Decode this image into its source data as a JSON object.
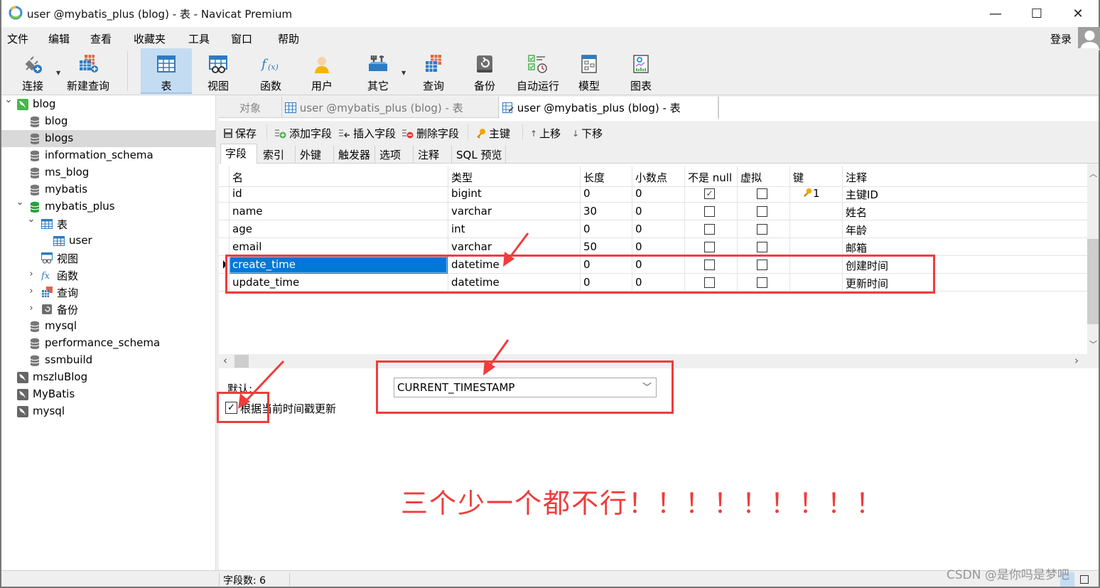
{
  "window": {
    "title": "user @mybatis_plus (blog) - 表 - Navicat Premium",
    "minimize": "—",
    "maximize": "☐",
    "close": "✕"
  },
  "menu": {
    "items": [
      "文件",
      "编辑",
      "查看",
      "收藏夹",
      "工具",
      "窗口",
      "帮助"
    ],
    "login": "登录"
  },
  "toolbar": {
    "items": [
      {
        "label": "连接",
        "icon": "plug-icon"
      },
      {
        "label": "新建查询",
        "icon": "new-query-icon"
      },
      {
        "label": "表",
        "icon": "table-icon",
        "active": true
      },
      {
        "label": "视图",
        "icon": "view-icon"
      },
      {
        "label": "函数",
        "icon": "function-icon"
      },
      {
        "label": "用户",
        "icon": "user-icon"
      },
      {
        "label": "其它",
        "icon": "tools-icon"
      },
      {
        "label": "查询",
        "icon": "query-icon"
      },
      {
        "label": "备份",
        "icon": "backup-icon"
      },
      {
        "label": "自动运行",
        "icon": "schedule-icon"
      },
      {
        "label": "模型",
        "icon": "model-icon"
      },
      {
        "label": "图表",
        "icon": "chart-icon"
      }
    ]
  },
  "tree": {
    "nodes": [
      {
        "label": "blog",
        "type": "connection",
        "level": 0,
        "expanded": true
      },
      {
        "label": "blog",
        "type": "database",
        "level": 1
      },
      {
        "label": "blogs",
        "type": "database",
        "level": 1,
        "selected": true
      },
      {
        "label": "information_schema",
        "type": "database",
        "level": 1
      },
      {
        "label": "ms_blog",
        "type": "database",
        "level": 1
      },
      {
        "label": "mybatis",
        "type": "database",
        "level": 1
      },
      {
        "label": "mybatis_plus",
        "type": "database-open",
        "level": 1,
        "expanded": true
      },
      {
        "label": "表",
        "type": "tables",
        "level": 2,
        "expanded": true
      },
      {
        "label": "user",
        "type": "table",
        "level": 3
      },
      {
        "label": "视图",
        "type": "views",
        "level": 2
      },
      {
        "label": "函数",
        "type": "functions",
        "level": 2,
        "collapsed": true
      },
      {
        "label": "查询",
        "type": "queries",
        "level": 2,
        "collapsed": true
      },
      {
        "label": "备份",
        "type": "backups",
        "level": 2,
        "collapsed": true
      },
      {
        "label": "mysql",
        "type": "database",
        "level": 1
      },
      {
        "label": "performance_schema",
        "type": "database",
        "level": 1
      },
      {
        "label": "ssmbuild",
        "type": "database",
        "level": 1
      },
      {
        "label": "mszluBlog",
        "type": "connection-closed",
        "level": 0
      },
      {
        "label": "MyBatis",
        "type": "connection-closed",
        "level": 0
      },
      {
        "label": "mysql",
        "type": "connection-closed",
        "level": 0
      }
    ]
  },
  "doc_tabs": {
    "objects": "对象",
    "tab1": "user @mybatis_plus (blog) - 表",
    "tab2": "user @mybatis_plus (blog) - 表"
  },
  "sub_toolbar": {
    "save": "保存",
    "add_field": "添加字段",
    "insert_field": "插入字段",
    "delete_field": "删除字段",
    "primary_key": "主键",
    "move_up": "上移",
    "move_down": "下移"
  },
  "inner_tabs": [
    "字段",
    "索引",
    "外键",
    "触发器",
    "选项",
    "注释",
    "SQL 预览"
  ],
  "grid": {
    "headers": [
      "名",
      "类型",
      "长度",
      "小数点",
      "不是 null",
      "虚拟",
      "键",
      "注释"
    ],
    "rows": [
      {
        "name": "id",
        "type": "bigint",
        "length": "0",
        "decimals": "0",
        "not_null": true,
        "virtual": false,
        "key": "1",
        "comment": "主键ID"
      },
      {
        "name": "name",
        "type": "varchar",
        "length": "30",
        "decimals": "0",
        "not_null": false,
        "virtual": false,
        "key": "",
        "comment": "姓名"
      },
      {
        "name": "age",
        "type": "int",
        "length": "0",
        "decimals": "0",
        "not_null": false,
        "virtual": false,
        "key": "",
        "comment": "年龄"
      },
      {
        "name": "email",
        "type": "varchar",
        "length": "50",
        "decimals": "0",
        "not_null": false,
        "virtual": false,
        "key": "",
        "comment": "邮箱"
      },
      {
        "name": "create_time",
        "type": "datetime",
        "length": "0",
        "decimals": "0",
        "not_null": false,
        "virtual": false,
        "key": "",
        "comment": "创建时间",
        "selected": true
      },
      {
        "name": "update_time",
        "type": "datetime",
        "length": "0",
        "decimals": "0",
        "not_null": false,
        "virtual": false,
        "key": "",
        "comment": "更新时间"
      }
    ]
  },
  "field_props": {
    "default_label": "默认:",
    "default_value": "CURRENT_TIMESTAMP",
    "update_on_timestamp_label": "根据当前时间戳更新",
    "update_on_timestamp": true
  },
  "annotation": {
    "note": "三个少一个都不行！！！！！！！！！",
    "color": "#f03c3c"
  },
  "status": {
    "field_count": "字段数: 6"
  },
  "watermark": "CSDN @是你吗是梦吧"
}
